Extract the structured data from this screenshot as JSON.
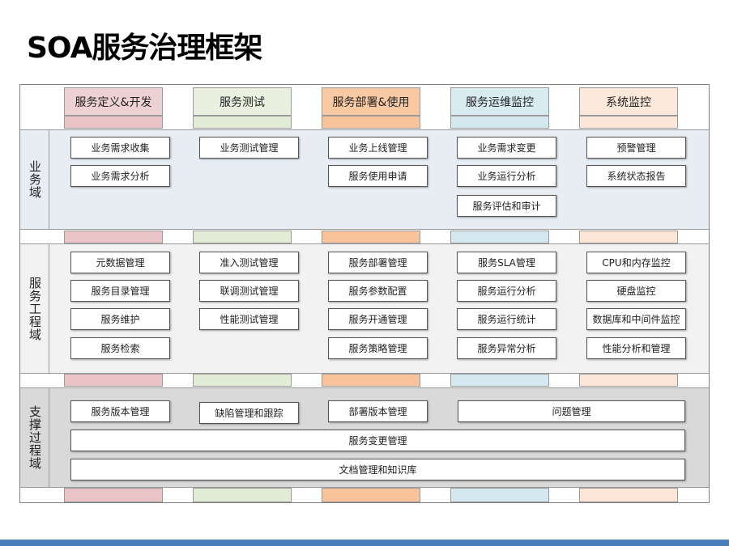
{
  "title": "SOA服务治理框架",
  "columns": [
    {
      "label": "服务定义&开发",
      "color": "#eed1d3",
      "strip": "#e9c3c6"
    },
    {
      "label": "服务测试",
      "color": "#eaf0e0",
      "strip": "#e3ecd6"
    },
    {
      "label": "服务部署&使用",
      "color": "#f9c9a4",
      "strip": "#f8c39b"
    },
    {
      "label": "服务运维监控",
      "color": "#d8ebf1",
      "strip": "#d3e8ef"
    },
    {
      "label": "系统监控",
      "color": "#fde9dc",
      "strip": "#fde6d7"
    }
  ],
  "domains": {
    "business": {
      "label": "业务域",
      "color": "#e8edf4",
      "items": [
        "业务需求收集",
        "业务需求分析",
        "业务测试管理",
        "业务上线管理",
        "服务使用申请",
        "业务需求变更",
        "业务运行分析",
        "服务评估和审计",
        "预警管理",
        "系统状态报告"
      ]
    },
    "engineering": {
      "label": "服务工程域",
      "color": "#f2f2f2",
      "items": [
        "元数据管理",
        "服务目录管理",
        "服务维护",
        "服务检索",
        "准入测试管理",
        "联调测试管理",
        "性能测试管理",
        "服务部署管理",
        "服务参数配置",
        "服务开通管理",
        "服务策略管理",
        "服务SLA管理",
        "服务运行分析",
        "服务运行统计",
        "服务异常分析",
        "CPU和内存监控",
        "硬盘监控",
        "数据库和中间件监控",
        "性能分析和管理"
      ]
    },
    "support": {
      "label": "支撑过程域",
      "color": "#d9d9d9",
      "items": [
        "服务版本管理",
        "缺陷管理和跟踪",
        "部署版本管理",
        "问题管理",
        "服务变更管理",
        "文档管理和知识库"
      ]
    }
  },
  "colors": {
    "footer_bar": "#4a7ebb",
    "box_border": "#555555"
  }
}
